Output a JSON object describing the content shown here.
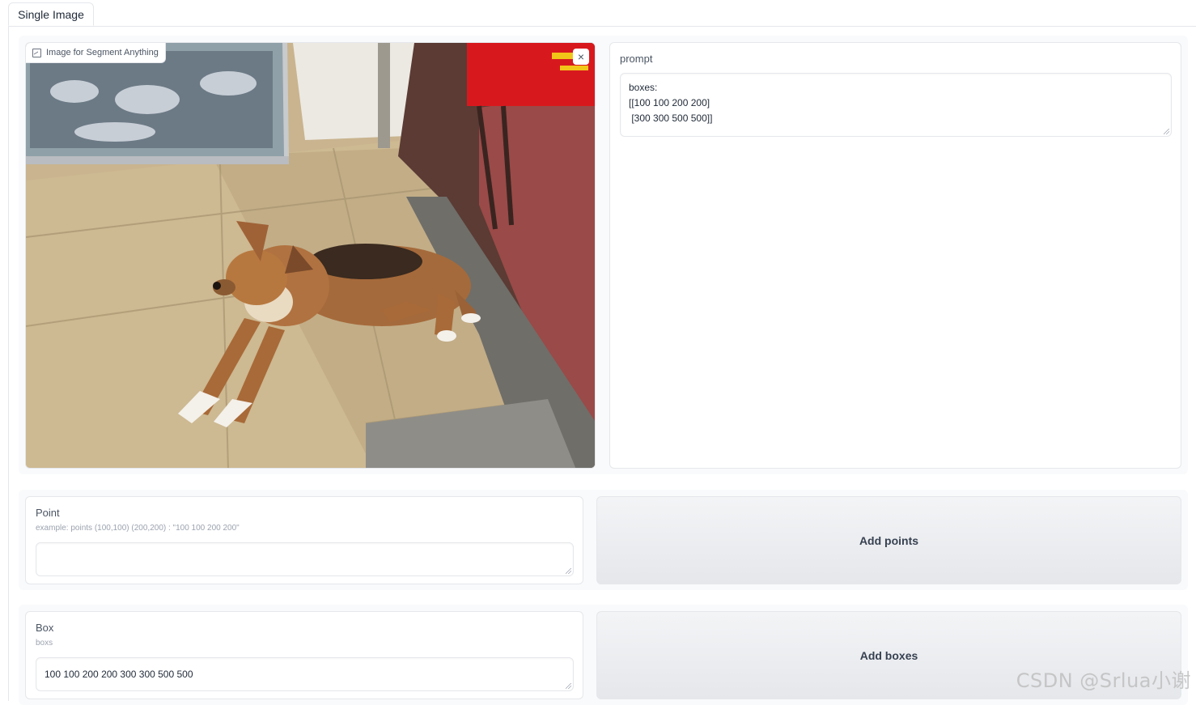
{
  "tabs": [
    {
      "label": "Single Image",
      "selected": true
    }
  ],
  "image_input": {
    "label": "Image for Segment Anything",
    "clear_symbol": "×",
    "image_description_icon": "photo-dog-lying-on-tiled-floor"
  },
  "prompt": {
    "label": "prompt",
    "value": "boxes:\n[[100 100 200 200]\n [300 300 500 500]]"
  },
  "point": {
    "label": "Point",
    "info": "example: points (100,100) (200,200) : \"100 100 200 200\"",
    "value": ""
  },
  "add_points_button": "Add points",
  "box": {
    "label": "Box",
    "info": "boxs",
    "value": "100 100 200 200 300 300 500 500"
  },
  "add_boxes_button": "Add boxes",
  "watermark": "CSDN @Srlua小谢",
  "colors": {
    "border": "#e5e7eb",
    "row_bg": "#f9fafb",
    "button_bg": "#e5e7eb"
  }
}
